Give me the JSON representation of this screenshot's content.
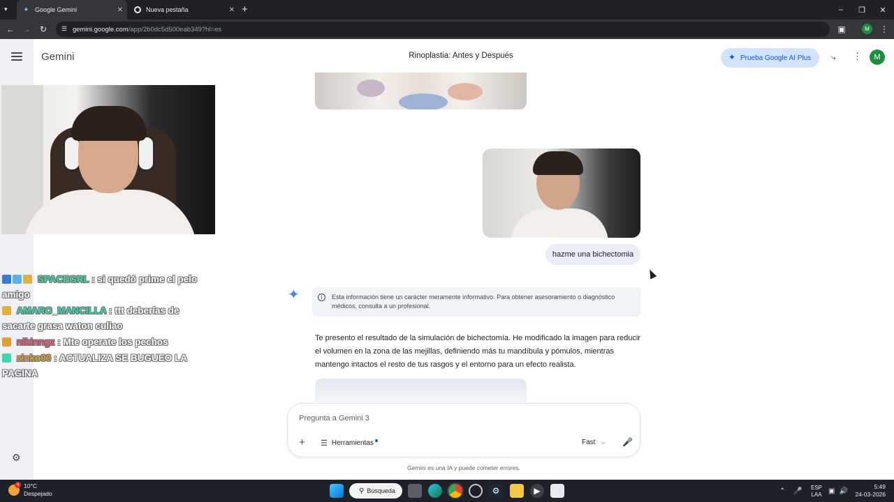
{
  "browser": {
    "tabs": [
      {
        "title": "Google Gemini",
        "icon": "gemini-spark-icon"
      },
      {
        "title": "Nueva pestaña",
        "icon": "chrome-icon"
      }
    ],
    "url_host": "gemini.google.com",
    "url_path": "/app/2b0dc5d500eab349?hl=es",
    "profile_initial": "M"
  },
  "gemini": {
    "brand": "Gemini",
    "conversation_title": "Rinoplastia: Antes y Después",
    "upgrade_label": "Prueba Google AI Plus",
    "avatar_initial": "M",
    "user_message": "hazme una bichectomia",
    "disclaimer": "Esta información tiene un carácter meramente informativo. Para obtener asesoramiento o diagnóstico médicos, consulta a un profesional.",
    "response": "Te presento el resultado de la simulación de bichectomía. He modificado la imagen para reducir el volumen en la zona de las mejillas, definiendo más tu mandíbula y pómulos, mientras mantengo intactos el resto de tus rasgos y el entorno para un efecto realista.",
    "composer": {
      "placeholder": "Pregunta a Gemini 3",
      "tools_label": "Herramientas",
      "mode_label": "Fast"
    },
    "footnote": "Gemini es una IA y puede cometer errores."
  },
  "stream_chat": [
    {
      "user": "SPACEGRL",
      "text": ": si quedó prime el pelo amigo",
      "color": "#3fd7b0"
    },
    {
      "user": "AMARO_MANCILLA",
      "text": ": ttt deberías de sacarte grasa waton culiao",
      "color": "#3fd7b0"
    },
    {
      "user": "nikinngz",
      "text": ": Mte operate los pechos",
      "color": "#e05a7a"
    },
    {
      "user": "zinko00",
      "text": ": ACTUALIZA SE BUGUEO LA PAGINA",
      "color": "#e0a030"
    }
  ],
  "taskbar": {
    "temperature": "10°C",
    "weather": "Despejado",
    "weather_alert": "4",
    "search_label": "Búsqueda",
    "lang_top": "ESP",
    "lang_bottom": "LAA",
    "time": "5:49",
    "date": "24-03-2026"
  }
}
